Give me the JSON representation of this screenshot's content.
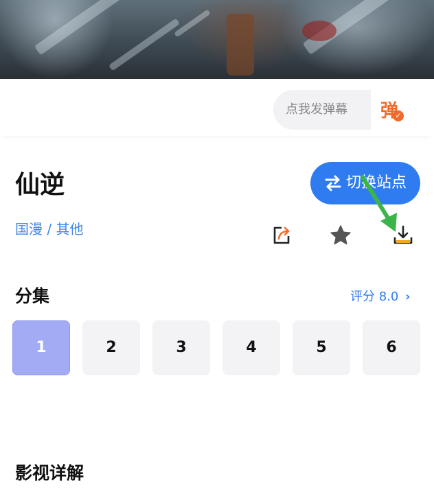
{
  "danmaku": {
    "placeholder": "点我发弹幕",
    "icon_glyph": "弹"
  },
  "show": {
    "title": "仙逆",
    "genre": "国漫 / 其他",
    "switch_label": "切换站点"
  },
  "actions": [
    {
      "name": "share-icon"
    },
    {
      "name": "star-icon"
    },
    {
      "name": "download-icon"
    }
  ],
  "episodes": {
    "section_title": "分集",
    "rating_label": "评分 8.0",
    "items": [
      "1",
      "2",
      "3",
      "4",
      "5",
      "6"
    ],
    "active_index": 0
  },
  "details": {
    "section_title": "影视详解"
  },
  "colors": {
    "accent": "#2f7cf0",
    "active_episode": "#a3abf5",
    "annotation": "#3bb54a"
  }
}
